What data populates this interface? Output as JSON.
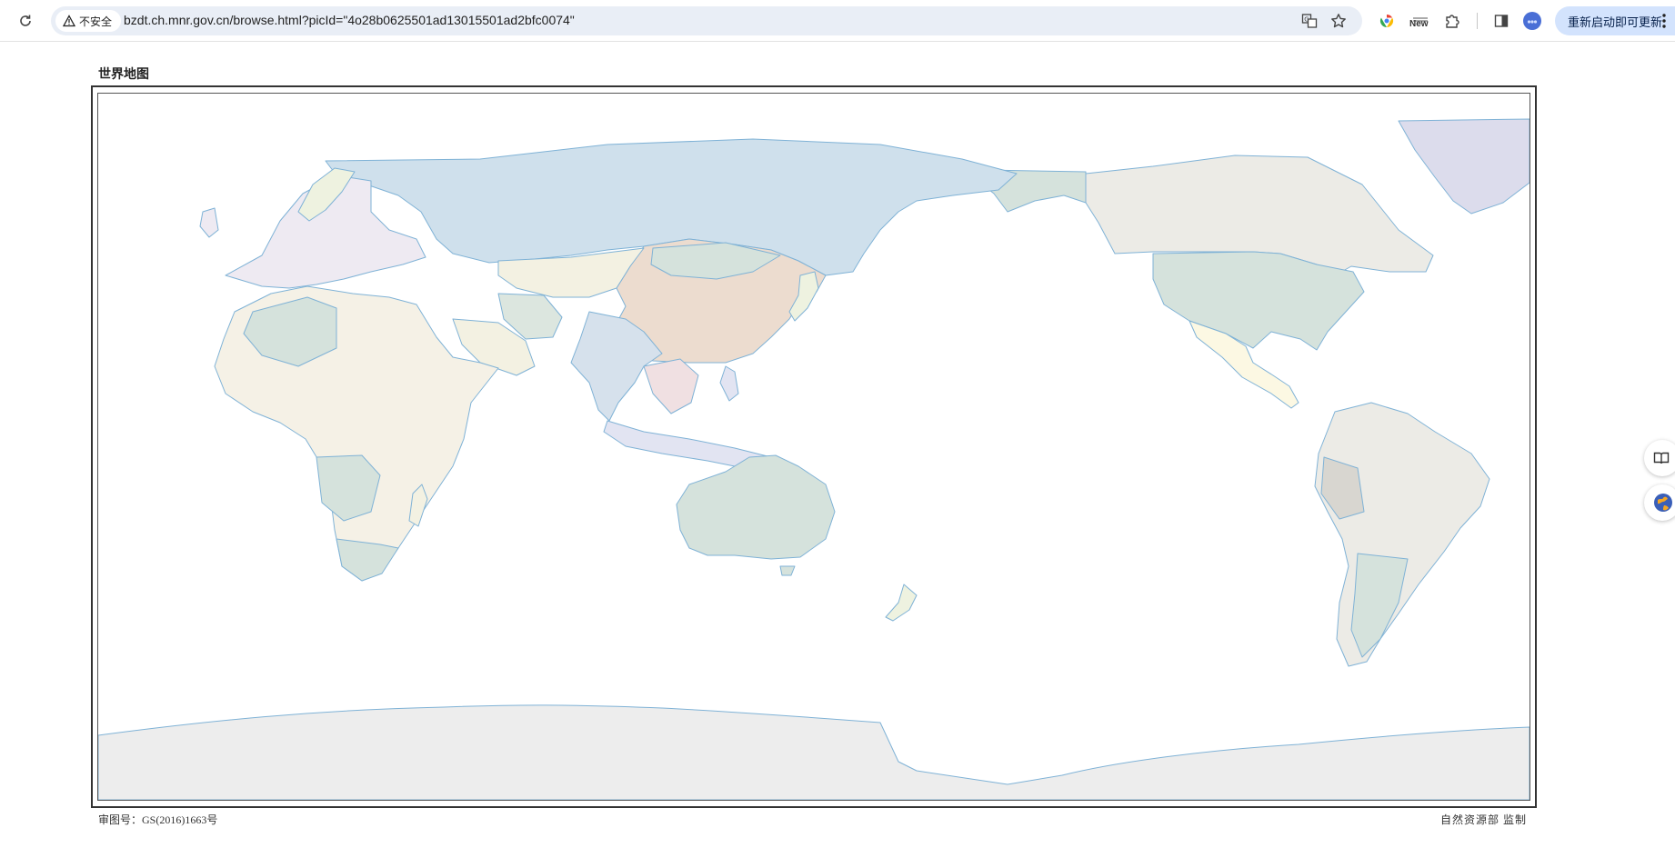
{
  "browser": {
    "security_label": "不安全",
    "url": "bzdt.ch.mnr.gov.cn/browse.html?picId=\"4o28b0625501ad13015501ad2bfc0074\"",
    "new_badge": "New",
    "update_button": "重新启动即可更新",
    "icons": [
      "reload-icon",
      "warning-icon",
      "translate-icon",
      "star-icon",
      "chrome-extension-icon",
      "new-extension-icon",
      "puzzle-icon",
      "side-panel-icon",
      "profile-icon",
      "more-icon"
    ]
  },
  "page": {
    "map_title": "世界地图",
    "approval_number": "审图号：GS(2016)1663号",
    "supervisor": "自然资源部  监制"
  },
  "colors": {
    "ocean": "#ffffff",
    "coast": "#7fb2d6",
    "russia": "#cfe0ec",
    "china": "#ecdccf",
    "usa": "#d5e2dc",
    "canada": "#ecebe6",
    "greenland": "#dcdcec",
    "antarctica": "#ededed",
    "australia": "#d5e2dc",
    "africa": "#f5f1e6"
  }
}
